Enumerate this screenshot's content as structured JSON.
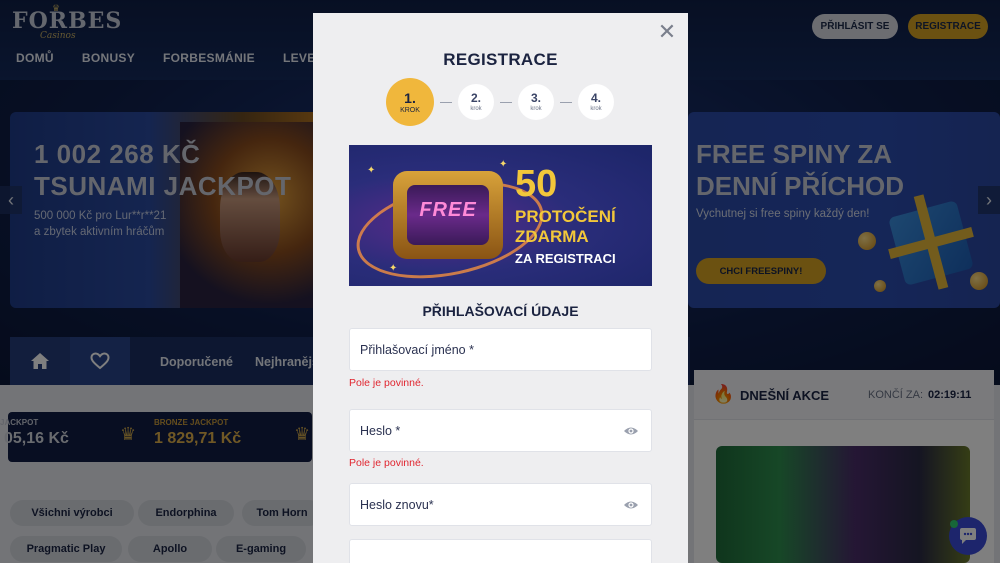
{
  "header": {
    "logo_text": "FORBES",
    "logo_sub": "Casinos",
    "nav": [
      "DOMŮ",
      "BONUSY",
      "FORBESMÁNIE",
      "LEVELOVÁ"
    ],
    "login_label": "PŘIHLÁSIT SE",
    "register_label": "REGISTRACE"
  },
  "hero_left": {
    "title_line1": "1 002 268 KČ",
    "title_line2": "TSUNAMI JACKPOT",
    "sub_line1": "500 000 Kč pro Lur**r**21",
    "sub_line2": "a zbytek aktivním hráčům"
  },
  "hero_right": {
    "title_line1": "FREE SPINY ZA",
    "title_line2": "DENNÍ PŘÍCHOD",
    "subtitle": "Vychutnej si free spiny každý den!",
    "cta": "CHCI FREESPINY!"
  },
  "tabs": [
    "Doporučené",
    "Nejhranější"
  ],
  "jackpots": {
    "first_label": "JACKPOT",
    "first_value": "05,16 Kč",
    "bronze_label": "BRONZE JACKPOT",
    "bronze_value": "1 829,71 Kč"
  },
  "providers": [
    "Všichni výrobci",
    "Endorphina",
    "Tom Horn",
    "Pragmatic Play",
    "Apollo",
    "E-gaming"
  ],
  "akce": {
    "title": "DNEŠNÍ AKCE",
    "ends_label": "KONČÍ ZA:",
    "time": "02:19:11"
  },
  "modal": {
    "title": "REGISTRACE",
    "steps": [
      {
        "num": "1.",
        "word": "KROK"
      },
      {
        "num": "2.",
        "word": "krok"
      },
      {
        "num": "3.",
        "word": "krok"
      },
      {
        "num": "4.",
        "word": "krok"
      }
    ],
    "promo": {
      "reel_text": "FREE",
      "big": "50",
      "line2": "PROTOČENÍ",
      "line3": "ZDARMA",
      "line4": "ZA REGISTRACI"
    },
    "section_title": "PŘIHLAŠOVACÍ ÚDAJE",
    "fields": {
      "username_placeholder": "Přihlašovací jméno *",
      "password_placeholder": "Heslo *",
      "password2_placeholder": "Heslo znovu*",
      "username_value": "",
      "password_value": "",
      "password2_value": ""
    },
    "error_required": "Pole je povinné."
  },
  "colors": {
    "accent_gold": "#d7a222",
    "navy": "#1b2340",
    "error_red": "#e0252f",
    "chat_blue": "#3a4bd8"
  }
}
